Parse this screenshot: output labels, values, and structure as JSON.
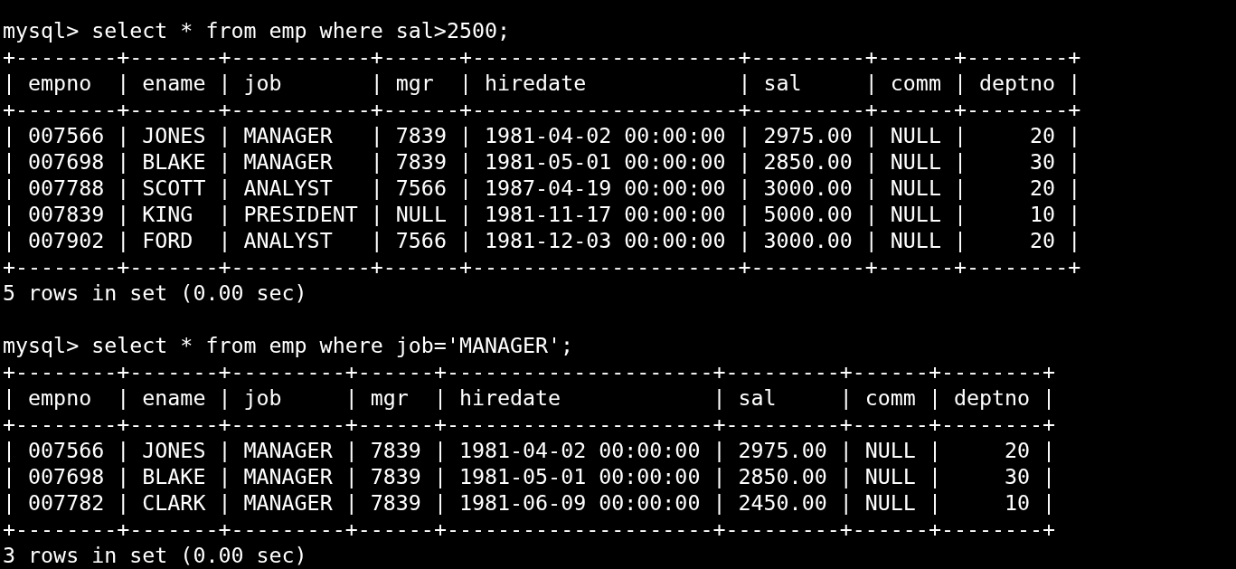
{
  "blocks": [
    {
      "prompt": "mysql>",
      "command": "select * from emp where sal>2500;",
      "output": [
        "+--------+-------+-----------+------+---------------------+---------+------+--------+",
        "| empno  | ename | job       | mgr  | hiredate            | sal     | comm | deptno |",
        "+--------+-------+-----------+------+---------------------+---------+------+--------+",
        "| 007566 | JONES | MANAGER   | 7839 | 1981-04-02 00:00:00 | 2975.00 | NULL |     20 |",
        "| 007698 | BLAKE | MANAGER   | 7839 | 1981-05-01 00:00:00 | 2850.00 | NULL |     30 |",
        "| 007788 | SCOTT | ANALYST   | 7566 | 1987-04-19 00:00:00 | 3000.00 | NULL |     20 |",
        "| 007839 | KING  | PRESIDENT | NULL | 1981-11-17 00:00:00 | 5000.00 | NULL |     10 |",
        "| 007902 | FORD  | ANALYST   | 7566 | 1981-12-03 00:00:00 | 3000.00 | NULL |     20 |",
        "+--------+-------+-----------+------+---------------------+---------+------+--------+"
      ],
      "status": "5 rows in set (0.00 sec)"
    },
    {
      "prompt": "mysql>",
      "command": "select * from emp where job='MANAGER';",
      "output": [
        "+--------+-------+---------+------+---------------------+---------+------+--------+",
        "| empno  | ename | job     | mgr  | hiredate            | sal     | comm | deptno |",
        "+--------+-------+---------+------+---------------------+---------+------+--------+",
        "| 007566 | JONES | MANAGER | 7839 | 1981-04-02 00:00:00 | 2975.00 | NULL |     20 |",
        "| 007698 | BLAKE | MANAGER | 7839 | 1981-05-01 00:00:00 | 2850.00 | NULL |     30 |",
        "| 007782 | CLARK | MANAGER | 7839 | 1981-06-09 00:00:00 | 2450.00 | NULL |     10 |",
        "+--------+-------+---------+------+---------------------+---------+------+--------+"
      ],
      "status": "3 rows in set (0.00 sec)"
    }
  ]
}
